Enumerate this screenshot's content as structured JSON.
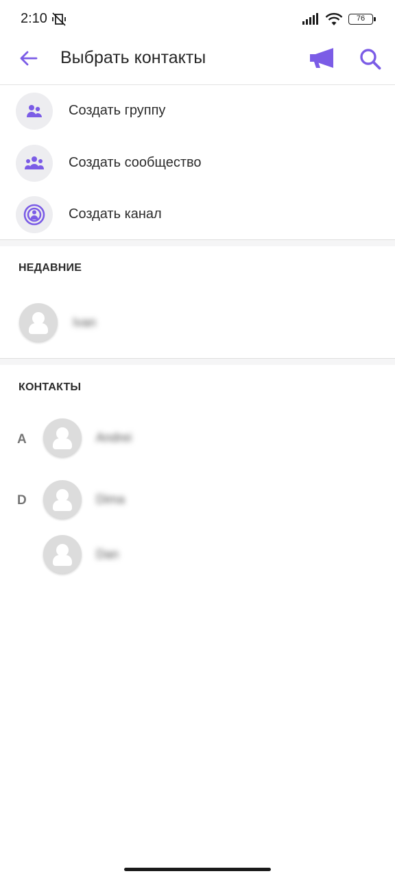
{
  "status_bar": {
    "time": "2:10",
    "battery": "76"
  },
  "app_bar": {
    "title": "Выбрать контакты"
  },
  "actions": [
    {
      "label": "Создать группу",
      "icon": "group-icon"
    },
    {
      "label": "Создать сообщество",
      "icon": "community-icon"
    },
    {
      "label": "Создать канал",
      "icon": "channel-icon"
    }
  ],
  "recent": {
    "header": "НЕДАВНИЕ",
    "items": [
      {
        "name": "Ivan"
      }
    ]
  },
  "contacts": {
    "header": "КОНТАКТЫ",
    "groups": [
      {
        "letter": "A",
        "items": [
          {
            "name": "Andrei"
          }
        ]
      },
      {
        "letter": "D",
        "items": [
          {
            "name": "Dima"
          },
          {
            "name": "Dan"
          }
        ]
      }
    ]
  },
  "colors": {
    "accent": "#7b5ce6",
    "icon_bg": "#ededf0",
    "avatar_bg": "#dcdcdc"
  }
}
